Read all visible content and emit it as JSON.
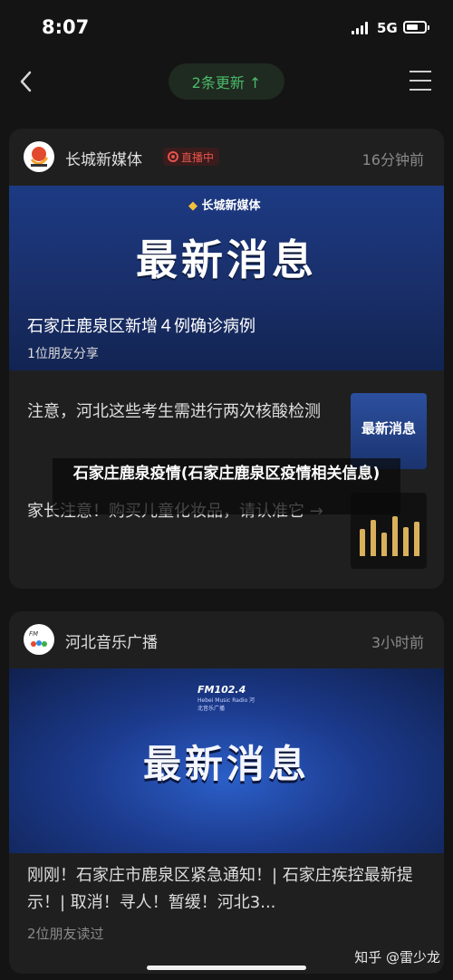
{
  "status_bar": {
    "time": "8:07",
    "network": "5G"
  },
  "nav": {
    "updates_pill": "2条更新 ↑"
  },
  "feed": [
    {
      "source": "长城新媒体",
      "live_badge": "直播中",
      "time_ago": "16分钟前",
      "hero_logo_text": "长城新媒体",
      "hero_title": "最新消息",
      "hero_caption": "石家庄鹿泉区新增４例确诊病例",
      "hero_subcaption": "1位朋友分享",
      "items": [
        {
          "text": "注意，河北这些考生需进行两次核酸检测",
          "thumb_text": "最新消息"
        },
        {
          "text": "家长注意！购买儿童化妆品，请认准它 →"
        }
      ]
    },
    {
      "source": "河北音乐广播",
      "time_ago": "3小时前",
      "hero_logo_text": "FM102.4",
      "hero_logo_subtext": "Hebei Music Radio 河北音乐广播",
      "hero_title": "最新消息",
      "caption": "刚刚！石家庄市鹿泉区紧急通知！| 石家庄疾控最新提示！| 取消！寻人！暂缓！河北3...",
      "readers": "2位朋友读过"
    }
  ],
  "overlay_title": "石家庄鹿泉疫情(石家庄鹿泉区疫情相关信息)",
  "watermark": "知乎 @雷少龙"
}
